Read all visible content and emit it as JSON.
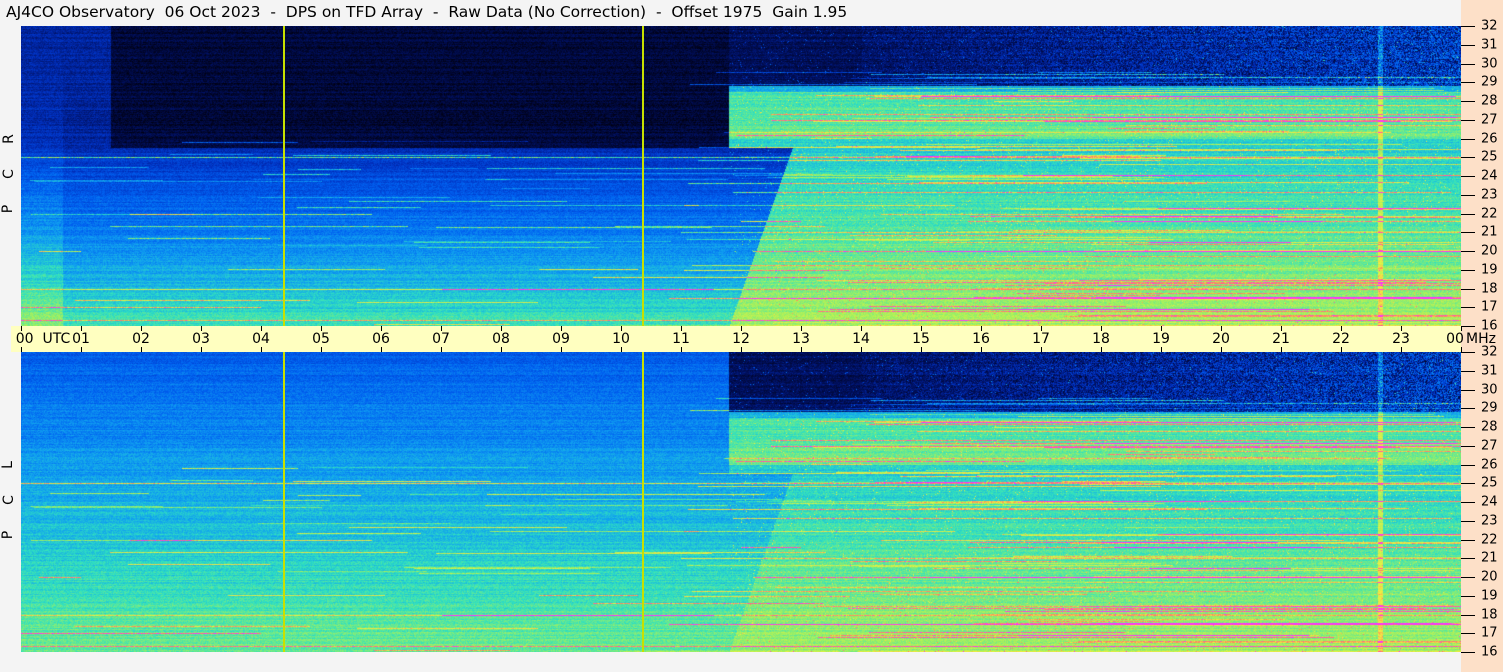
{
  "chart_data": {
    "type": "heatmap",
    "title": "AJ4CO Observatory  06 Oct 2023  -  DPS on TFD Array  -  Raw Data (No Correction)  -  Offset 1975  Gain 1.95",
    "xlabel": "UTC",
    "ylabel": "MHz",
    "x_range_hours": [
      0,
      24
    ],
    "y_range_mhz": [
      16,
      32
    ],
    "x_ticks": [
      "00",
      "01",
      "02",
      "03",
      "04",
      "05",
      "06",
      "07",
      "08",
      "09",
      "10",
      "11",
      "12",
      "13",
      "14",
      "15",
      "16",
      "17",
      "18",
      "19",
      "20",
      "21",
      "22",
      "23",
      "00"
    ],
    "y_ticks": [
      16,
      17,
      18,
      19,
      20,
      21,
      22,
      23,
      24,
      25,
      26,
      27,
      28,
      29,
      30,
      31,
      32
    ],
    "panels": [
      {
        "name": "R C P",
        "letters": [
          "R",
          "C",
          "P"
        ]
      },
      {
        "name": "L C P",
        "letters": [
          "L",
          "C",
          "P"
        ]
      }
    ],
    "markers_utc_hours": [
      4.37,
      10.35
    ],
    "colormap": [
      "#000010",
      "#001060",
      "#0030c0",
      "#0060f0",
      "#10a0f0",
      "#30e0c0",
      "#a0f060",
      "#f0f040",
      "#ff8060",
      "#ff30ff"
    ],
    "marker_color": "#c8e000",
    "axis_strip_color": "#ffffc0",
    "right_axis_color": "#fde0c8"
  }
}
